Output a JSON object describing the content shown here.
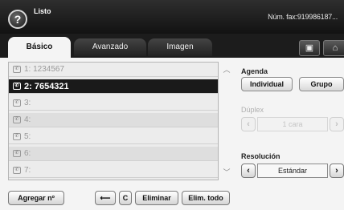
{
  "header": {
    "help_glyph": "?",
    "status": "Listo",
    "fax_info": "Núm. fax:919986187..."
  },
  "tabs": [
    {
      "label": "Básico",
      "active": true
    },
    {
      "label": "Avanzado",
      "active": false
    },
    {
      "label": "Imagen",
      "active": false
    }
  ],
  "corner_buttons": {
    "contacts_icon": "contacts-icon",
    "home_icon": "home-icon"
  },
  "recipients": [
    {
      "label": "1: 1234567",
      "selected": false
    },
    {
      "label": "2: 7654321",
      "selected": true
    },
    {
      "label": "3:",
      "selected": false
    },
    {
      "label": "4:",
      "selected": false
    },
    {
      "label": "5:",
      "selected": false
    },
    {
      "label": "6:",
      "selected": false
    },
    {
      "label": "7:",
      "selected": false
    }
  ],
  "agenda": {
    "label": "Agenda",
    "individual": "Individual",
    "grupo": "Grupo"
  },
  "duplex": {
    "label": "Dúplex",
    "value": "1 cara",
    "enabled": false
  },
  "resolucion": {
    "label": "Resolución",
    "value": "Estándar"
  },
  "bottom": {
    "add": "Agregar nº",
    "backspace_glyph": "⟵",
    "clear": "C",
    "delete": "Eliminar",
    "delete_all": "Elim. todo"
  }
}
